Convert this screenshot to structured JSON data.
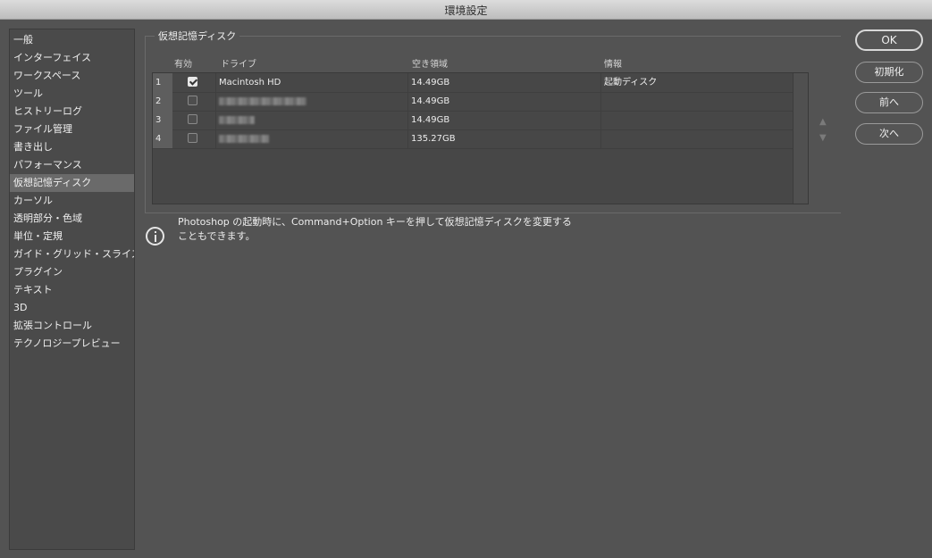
{
  "window": {
    "title": "環境設定"
  },
  "sidebar": {
    "items": [
      {
        "label": "一般"
      },
      {
        "label": "インターフェイス"
      },
      {
        "label": "ワークスペース"
      },
      {
        "label": "ツール"
      },
      {
        "label": "ヒストリーログ"
      },
      {
        "label": "ファイル管理"
      },
      {
        "label": "書き出し"
      },
      {
        "label": "パフォーマンス"
      },
      {
        "label": "仮想記憶ディスク",
        "selected": true
      },
      {
        "label": "カーソル"
      },
      {
        "label": "透明部分・色域"
      },
      {
        "label": "単位・定規"
      },
      {
        "label": "ガイド・グリッド・スライス"
      },
      {
        "label": "プラグイン"
      },
      {
        "label": "テキスト"
      },
      {
        "label": "3D"
      },
      {
        "label": "拡張コントロール"
      },
      {
        "label": "テクノロジープレビュー"
      }
    ]
  },
  "section": {
    "title": "仮想記憶ディスク",
    "columns": {
      "enabled": "有効",
      "drive": "ドライブ",
      "free_space": "空き領域",
      "info": "情報"
    },
    "rows": [
      {
        "num": "1",
        "checked": true,
        "drive": "Macintosh HD",
        "blurred": false,
        "free": "14.49GB",
        "info": "起動ディスク"
      },
      {
        "num": "2",
        "checked": false,
        "drive": "",
        "blurred": true,
        "free": "14.49GB",
        "info": ""
      },
      {
        "num": "3",
        "checked": false,
        "drive": "",
        "blurred": true,
        "free": "14.49GB",
        "info": ""
      },
      {
        "num": "4",
        "checked": false,
        "drive": "",
        "blurred": true,
        "free": "135.27GB",
        "info": ""
      }
    ],
    "move_up_icon": "triangle-up-icon",
    "move_down_icon": "triangle-down-icon"
  },
  "info": {
    "icon": "info-icon",
    "line1": "Photoshop の起動時に、Command+Option キーを押して仮想記憶ディスクを変更する",
    "line2": "こともできます。"
  },
  "buttons": {
    "ok": "OK",
    "reset": "初期化",
    "prev": "前へ",
    "next": "次へ"
  }
}
